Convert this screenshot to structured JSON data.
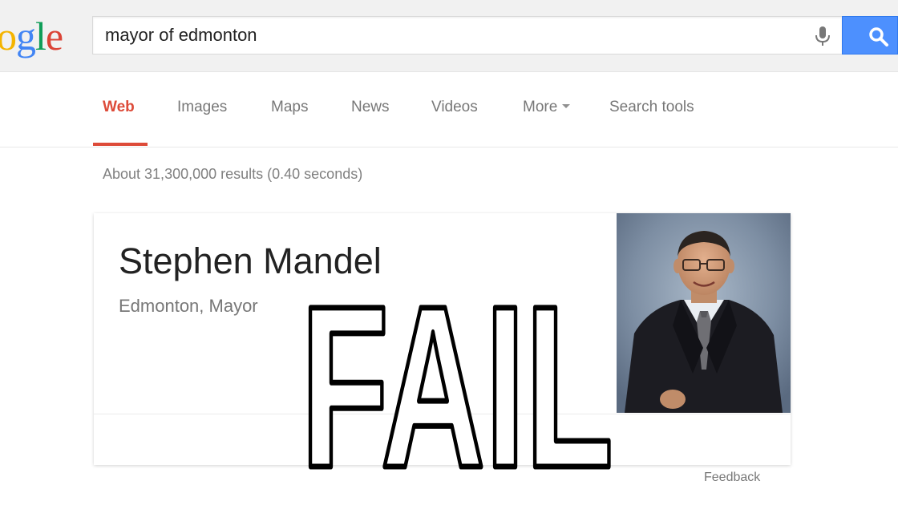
{
  "logo": {
    "text": "ogle"
  },
  "search": {
    "query": "mayor of edmonton"
  },
  "icons": {
    "mic": "microphone-icon",
    "search": "magnifier-icon",
    "more": "caret-down-icon"
  },
  "tabs": [
    {
      "label": "Web",
      "active": true
    },
    {
      "label": "Images",
      "active": false
    },
    {
      "label": "Maps",
      "active": false
    },
    {
      "label": "News",
      "active": false
    },
    {
      "label": "Videos",
      "active": false
    },
    {
      "label": "More",
      "active": false
    },
    {
      "label": "Search tools",
      "active": false
    }
  ],
  "result_stats": "About 31,300,000 results (0.40 seconds)",
  "knowledge_panel": {
    "title": "Stephen Mandel",
    "subtitle": "Edmonton, Mayor"
  },
  "overlay": {
    "text": "FAIL"
  },
  "feedback": "Feedback",
  "colors": {
    "accent_red": "#dd4b39",
    "search_blue": "#4d90fe",
    "header_bg": "#f1f1f1"
  }
}
